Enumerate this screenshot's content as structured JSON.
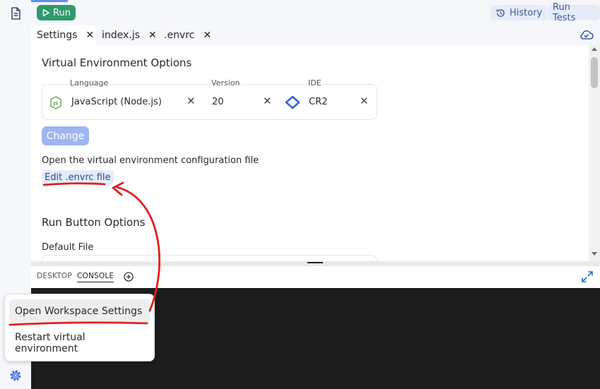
{
  "toolbar": {
    "run_label": "Run",
    "history_label": "History",
    "run_tests_label": "Run Tests"
  },
  "tabs": [
    {
      "label": "Settings",
      "active": true
    },
    {
      "label": "index.js",
      "active": false
    },
    {
      "label": ".envrc",
      "active": false
    }
  ],
  "settings": {
    "venv_heading": "Virtual Environment Options",
    "language_label": "Language",
    "language_value": "JavaScript (Node.js)",
    "version_label": "Version",
    "version_value": "20",
    "ide_label": "IDE",
    "ide_value": "CR2",
    "change_label": "Change",
    "config_desc": "Open the virtual environment configuration file",
    "edit_link": "Edit .envrc file",
    "run_heading": "Run Button Options",
    "default_file_label": "Default File"
  },
  "console": {
    "tabs": [
      {
        "label": "DESKTOP",
        "active": false
      },
      {
        "label": "CONSOLE",
        "active": true
      }
    ]
  },
  "menu": {
    "items": [
      {
        "label": "Open Workspace Settings",
        "highlighted": true
      },
      {
        "label": "Restart virtual environment",
        "highlighted": false
      }
    ]
  },
  "colors": {
    "run_green": "#2e9a6b",
    "accent_blue": "#5f8ef4",
    "annotation_red": "#e02020",
    "console_bg": "#1c1c1c"
  }
}
